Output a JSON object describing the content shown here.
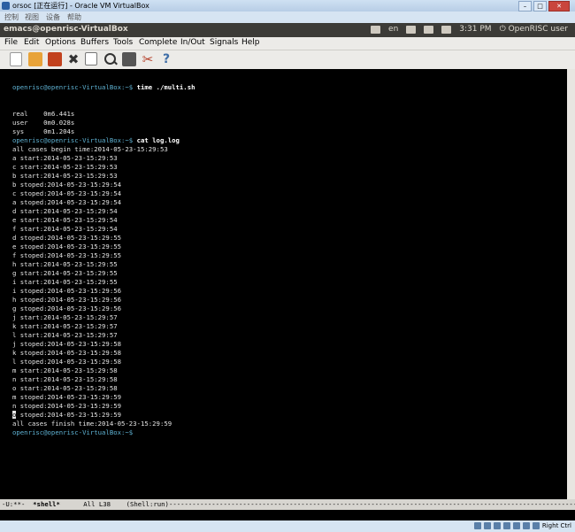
{
  "vbox": {
    "title": "orsoc [正在运行] - Oracle VM VirtualBox",
    "menu": [
      "控制",
      "视图",
      "设备",
      "帮助"
    ],
    "min": "–",
    "max": "□",
    "close": "✕"
  },
  "panel": {
    "app_name": "emacs@openrisc-VirtualBox",
    "keyboard": "en",
    "time": "3:31 PM",
    "user": "OpenRISC user"
  },
  "emacs_menu": [
    "File",
    "Edit",
    "Options",
    "Buffers",
    "Tools",
    "Complete",
    "In/Out",
    "Signals",
    "Help"
  ],
  "toolbar_icons": [
    "new-file-icon",
    "open-folder-icon",
    "save-icon",
    "close-icon",
    "copy-icon",
    "search-icon",
    "print-icon",
    "preferences-icon",
    "help-icon"
  ],
  "terminal": {
    "prompt": "openrisc@openrisc-VirtualBox:~$",
    "cmd1": "time ./multi.sh",
    "real": "real\t0m6.441s",
    "user": "user\t0m0.028s",
    "sys": "sys\t0m1.204s",
    "cmd2": "cat log.log",
    "begin": "all cases begin time:2014-05-23-15:29:53",
    "log": [
      "a start:2014-05-23-15:29:53",
      "c start:2014-05-23-15:29:53",
      "b start:2014-05-23-15:29:53",
      "b stoped:2014-05-23-15:29:54",
      "c stoped:2014-05-23-15:29:54",
      "a stoped:2014-05-23-15:29:54",
      "d start:2014-05-23-15:29:54",
      "e start:2014-05-23-15:29:54",
      "f start:2014-05-23-15:29:54",
      "d stoped:2014-05-23-15:29:55",
      "e stoped:2014-05-23-15:29:55",
      "f stoped:2014-05-23-15:29:55",
      "h start:2014-05-23-15:29:55",
      "g start:2014-05-23-15:29:55",
      "i start:2014-05-23-15:29:55",
      "i stoped:2014-05-23-15:29:56",
      "h stoped:2014-05-23-15:29:56",
      "g stoped:2014-05-23-15:29:56",
      "j start:2014-05-23-15:29:57",
      "k start:2014-05-23-15:29:57",
      "l start:2014-05-23-15:29:57",
      "j stoped:2014-05-23-15:29:58",
      "k stoped:2014-05-23-15:29:58",
      "l stoped:2014-05-23-15:29:58",
      "m start:2014-05-23-15:29:58",
      "n start:2014-05-23-15:29:58",
      "o start:2014-05-23-15:29:58",
      "m stoped:2014-05-23-15:29:59",
      "n stoped:2014-05-23-15:29:59"
    ],
    "last_log_cursor": "o",
    "last_log_rest": " stoped:2014-05-23-15:29:59",
    "finish": "all cases finish time:2014-05-23-15:29:59"
  },
  "modeline": {
    "status": "-U:**-  ",
    "buffer": "*shell*",
    "position": "      All L38    ",
    "mode": "(Shell:run)",
    "fill": "-----------------------------------------------------------------------------------------------------------------"
  },
  "statusbar": {
    "host_key": "Right Ctrl"
  }
}
